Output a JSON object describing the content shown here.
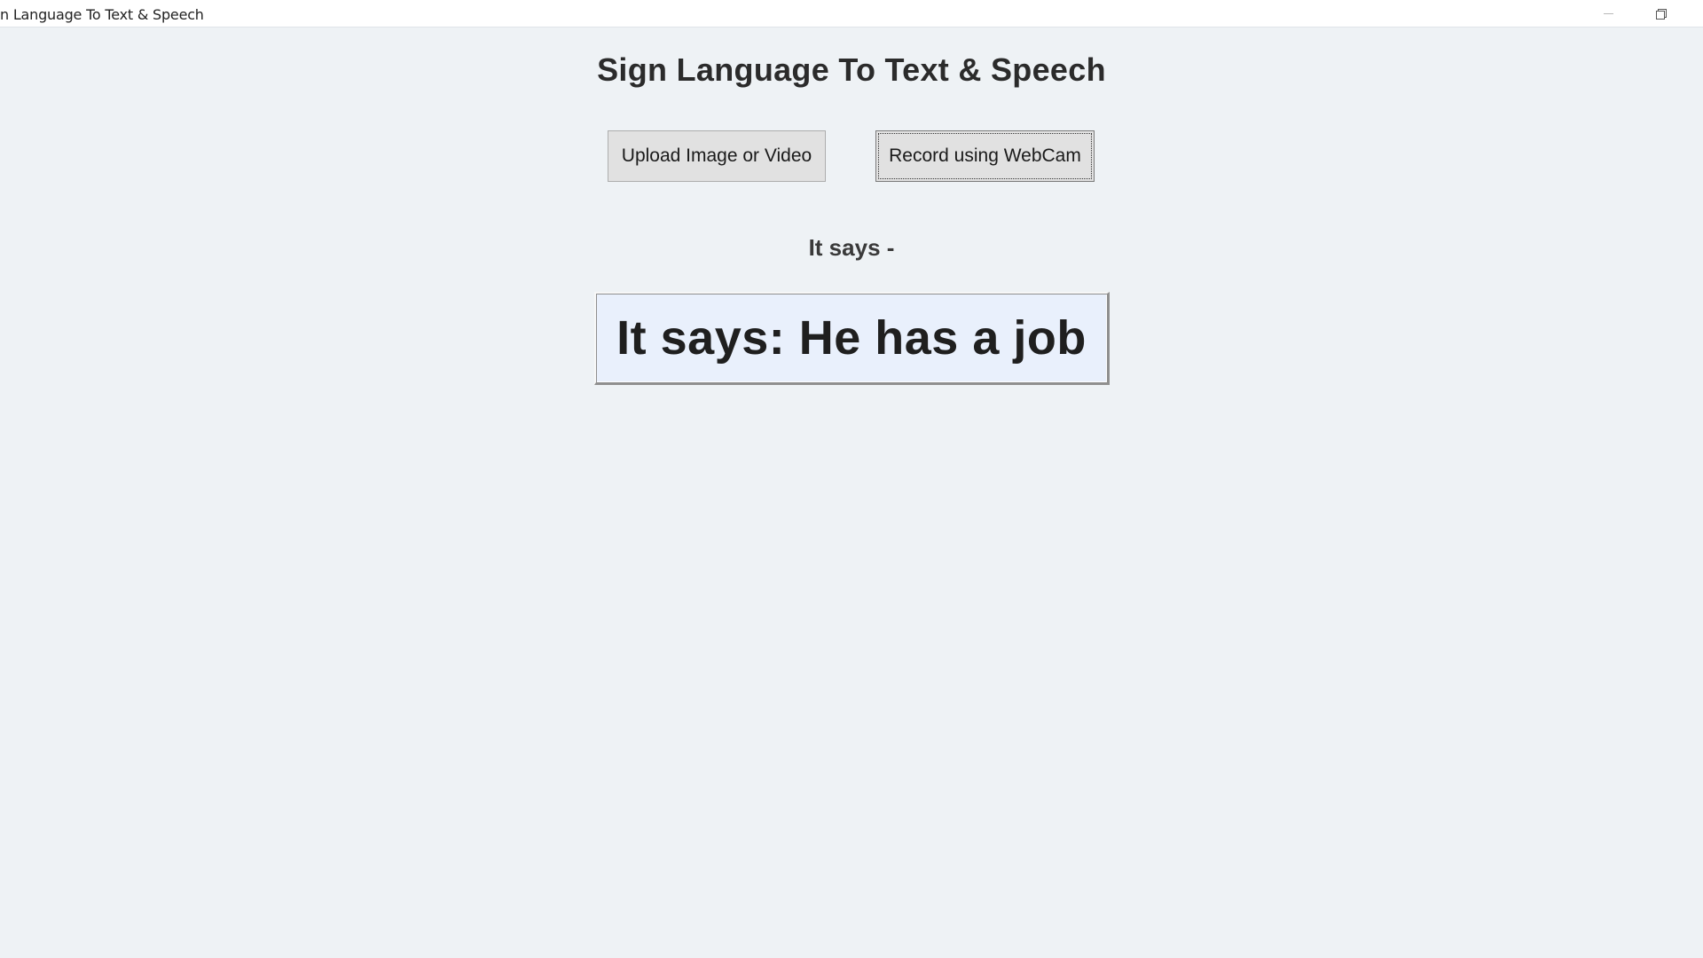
{
  "window": {
    "title": "n Language To Text & Speech",
    "controls": {
      "minimize_icon": "minimize-icon",
      "maximize_icon": "restore-icon"
    }
  },
  "main": {
    "heading": "Sign Language To Text & Speech",
    "buttons": {
      "upload_label": "Upload Image or Video",
      "webcam_label": "Record using WebCam"
    },
    "output_label": "It says -",
    "output_text": "It says: He has a job"
  },
  "colors": {
    "background": "#eef2f5",
    "result_box": "#e9f0fc",
    "button": "#e1e1e1"
  }
}
